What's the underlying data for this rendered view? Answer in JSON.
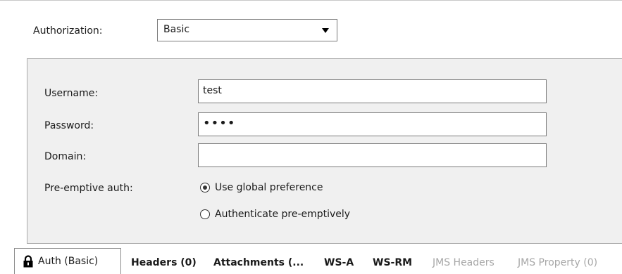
{
  "authorization": {
    "label": "Authorization:",
    "selected": "Basic"
  },
  "form": {
    "username_label": "Username:",
    "username_value": "test",
    "password_label": "Password:",
    "password_mask": "••••",
    "domain_label": "Domain:",
    "domain_value": "",
    "preemptive_label": "Pre-emptive auth:",
    "options": [
      {
        "label": "Use global preference",
        "checked": true
      },
      {
        "label": "Authenticate pre-emptively",
        "checked": false
      }
    ]
  },
  "tabs": [
    {
      "label": "Auth (Basic)",
      "icon": "lock-icon",
      "active": true,
      "enabled": true
    },
    {
      "label": "Headers (0)",
      "active": false,
      "enabled": true
    },
    {
      "label": "Attachments (...",
      "active": false,
      "enabled": true
    },
    {
      "label": "WS-A",
      "active": false,
      "enabled": true
    },
    {
      "label": "WS-RM",
      "active": false,
      "enabled": true
    },
    {
      "label": "JMS Headers",
      "active": false,
      "enabled": false
    },
    {
      "label": "JMS Property (0)",
      "active": false,
      "enabled": false
    }
  ]
}
